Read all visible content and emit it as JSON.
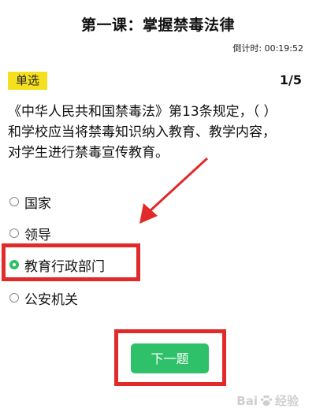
{
  "header": {
    "title": "第一课：掌握禁毒法律",
    "timer": "倒计时: 00:19:52"
  },
  "question": {
    "type": "单选",
    "progress": "1/5",
    "text_line1": "《中华人民共和国禁毒法》第13条规定，（ ）",
    "text_line2": "和学校应当将禁毒知识纳入教育、教学内容，",
    "text_line3": "对学生进行禁毒宣传教育。"
  },
  "options": [
    {
      "label": "国家",
      "selected": false
    },
    {
      "label": "领导",
      "selected": false
    },
    {
      "label": "教育行政部门",
      "selected": true
    },
    {
      "label": "公安机关",
      "selected": false
    }
  ],
  "actions": {
    "next_label": "下一题"
  },
  "watermark": {
    "left": "Bai",
    "right": "经验"
  },
  "colors": {
    "accent_green": "#2ec16a",
    "badge_yellow": "#f5e01f",
    "annotation_red": "#e12a2a"
  }
}
